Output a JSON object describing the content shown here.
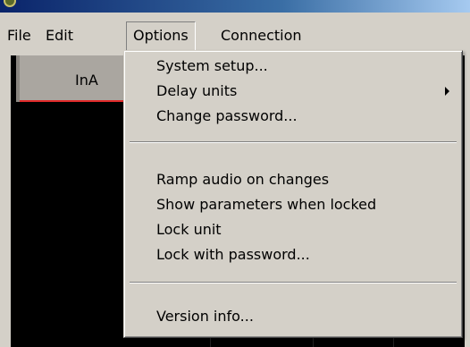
{
  "menubar": {
    "file": "File",
    "edit": "Edit",
    "options": "Options",
    "connection": "Connection"
  },
  "panel": {
    "input_tab_label": "InA"
  },
  "options_menu": {
    "items": [
      "System setup...",
      "Delay units",
      "Change password...",
      "Ramp audio on changes",
      "Show parameters when locked",
      "Lock unit",
      "Lock with password...",
      "Version info..."
    ]
  },
  "colors": {
    "menu_bg": "#d4d0c8",
    "panel_bg": "#000000",
    "tab_accent": "#e02a2a"
  }
}
